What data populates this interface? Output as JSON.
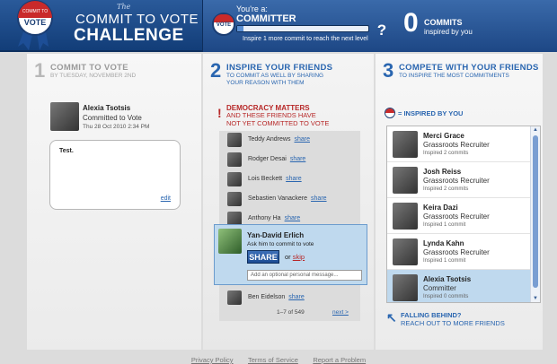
{
  "header": {
    "logo_the": "The",
    "logo_line1": "COMMIT TO VOTE",
    "logo_line2": "CHALLENGE",
    "badge_text": "COMMIT TO VOTE",
    "vote_badge_text": "VOTE",
    "youre_a": "You're a:",
    "rank": "COMMITTER",
    "progress_fraction": 0.05,
    "inspire_note": "Inspire 1 more commit to reach the next level",
    "count": "0",
    "count_label": "COMMITS",
    "count_sub": "inspired by you"
  },
  "step1": {
    "num": "1",
    "title": "COMMIT TO VOTE",
    "sub": "BY TUESDAY, NOVEMBER 2ND",
    "name": "Alexia Tsotsis",
    "status": "Committed to Vote",
    "date": "Thu 28 Oct 2010 2:34 PM",
    "message": "Test.",
    "edit": "edit"
  },
  "step2": {
    "num": "2",
    "title": "INSPIRE YOUR FRIENDS",
    "sub_line1": "TO COMMIT AS WELL BY SHARING",
    "sub_line2": "YOUR REASON WITH THEM",
    "alert_mark": "!",
    "dem_title": "DEMOCRACY MATTERS",
    "dem_sub_line1": "AND THESE FRIENDS HAVE",
    "dem_sub_line2": "NOT YET COMMITTED TO VOTE",
    "share_label": "share",
    "friends": [
      {
        "name": "Teddy Andrews"
      },
      {
        "name": "Rodger Desai"
      },
      {
        "name": "Lois Beckett"
      },
      {
        "name": "Sebastien Vanackere"
      },
      {
        "name": "Anthony Ha"
      },
      {
        "name": "Ben Eidelson"
      }
    ],
    "popup": {
      "name": "Yan-David Erlich",
      "ask": "Ask him to commit to vote",
      "share_button": "SHARE",
      "or": "or",
      "skip": "skip",
      "placeholder": "Add an optional personal message..."
    },
    "pager": "1–7 of 549",
    "next": "next >"
  },
  "step3": {
    "num": "3",
    "title": "COMPETE WITH YOUR FRIENDS",
    "sub": "TO INSPIRE THE MOST COMMITMENTS",
    "inspired_label": "= INSPIRED BY YOU",
    "inspired": [
      {
        "name": "Merci Grace",
        "role": "Grassroots Recruiter",
        "count": "Inspired 2 commits"
      },
      {
        "name": "Josh Reiss",
        "role": "Grassroots Recruiter",
        "count": "Inspired 2 commits"
      },
      {
        "name": "Keira Dazi",
        "role": "Grassroots Recruiter",
        "count": "Inspired 1 commit"
      },
      {
        "name": "Lynda Kahn",
        "role": "Grassroots Recruiter",
        "count": "Inspired 1 commit"
      },
      {
        "name": "Alexia Tsotsis",
        "role": "Committer",
        "count": "Inspired 0 commits"
      }
    ],
    "falling_title": "FALLING BEHIND?",
    "falling_sub": "REACH OUT TO MORE FRIENDS"
  },
  "footer": {
    "privacy": "Privacy Policy",
    "terms": "Terms of Service",
    "report": "Report a Problem"
  },
  "colors": {
    "brand_blue": "#1d4785",
    "accent_blue": "#2a66b0",
    "alert_red": "#b72828"
  },
  "icons": {
    "badge": "ribbon-badge-icon",
    "vote": "vote-button-icon",
    "help": "question-icon",
    "arrow": "arrow-up-left-icon"
  }
}
